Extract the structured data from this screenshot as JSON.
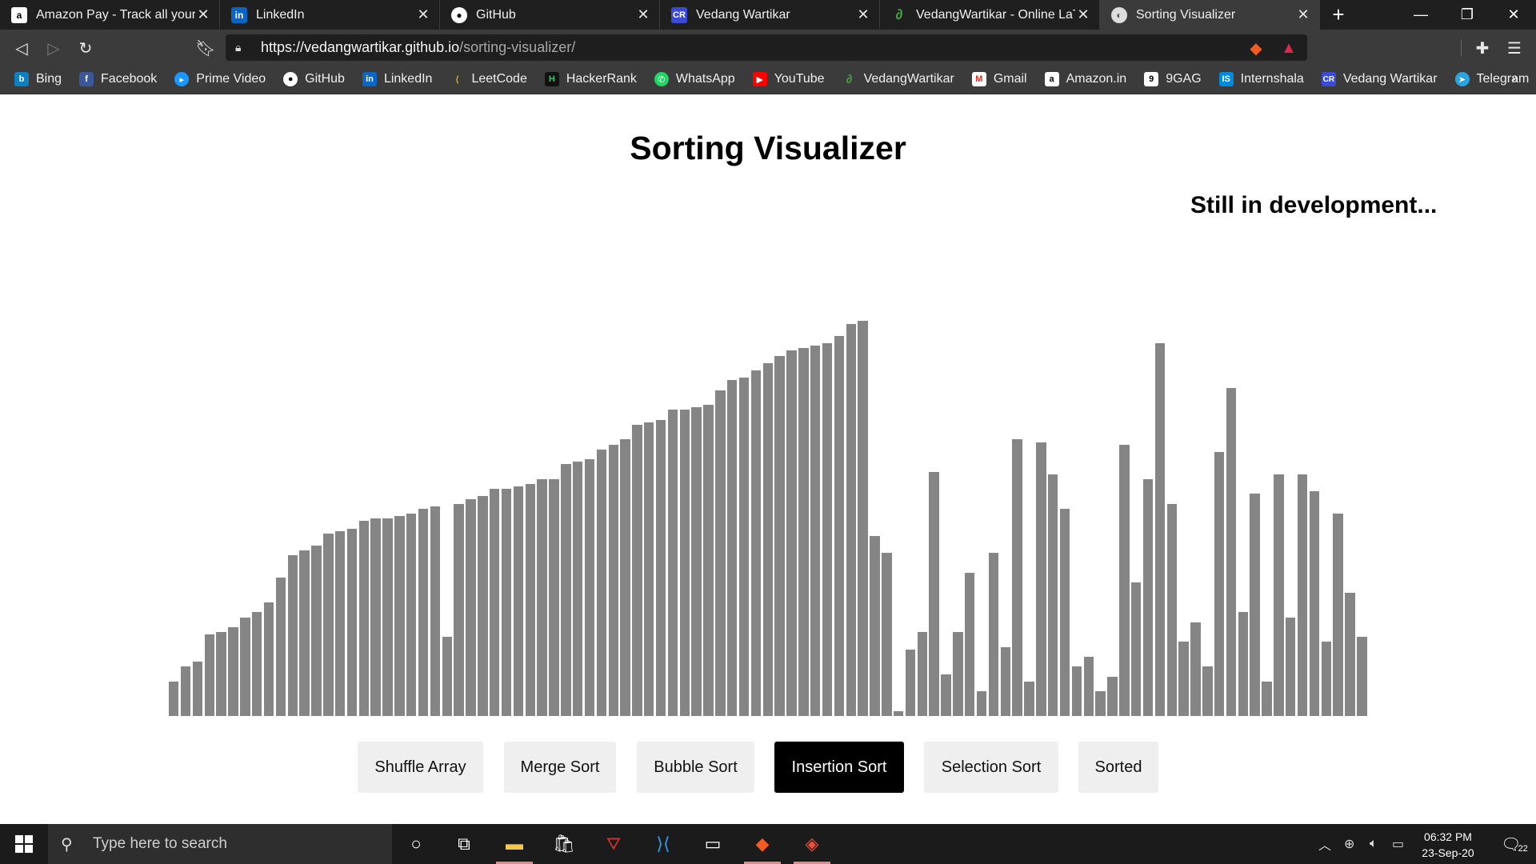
{
  "browser": {
    "tabs": [
      {
        "title": "Amazon Pay - Track all your payments",
        "icon": "amazon-icon",
        "active": false
      },
      {
        "title": "LinkedIn",
        "icon": "linkedin-icon",
        "active": false
      },
      {
        "title": "GitHub",
        "icon": "github-icon",
        "active": false
      },
      {
        "title": "Vedang Wartikar",
        "icon": "cr-icon",
        "active": false
      },
      {
        "title": "VedangWartikar - Online LaTeX",
        "icon": "overleaf-icon",
        "active": false
      },
      {
        "title": "Sorting Visualizer",
        "icon": "globe-icon",
        "active": true
      }
    ],
    "new_tab_label": "+",
    "url_host": "https://vedangwartikar.github.io",
    "url_path": "/sorting-visualizer/",
    "bookmarks": [
      {
        "label": "Bing",
        "icon": "bing-icon",
        "color": "#0e7fbf"
      },
      {
        "label": "Facebook",
        "icon": "facebook-icon",
        "color": "#3b5998"
      },
      {
        "label": "Prime Video",
        "icon": "prime-video-icon",
        "color": "#1a98ff"
      },
      {
        "label": "GitHub",
        "icon": "github-icon",
        "color": "#333333"
      },
      {
        "label": "LinkedIn",
        "icon": "linkedin-icon",
        "color": "#0a66c2"
      },
      {
        "label": "LeetCode",
        "icon": "leetcode-icon",
        "color": "#e7a41c"
      },
      {
        "label": "HackerRank",
        "icon": "hackerrank-icon",
        "color": "#111111"
      },
      {
        "label": "WhatsApp",
        "icon": "whatsapp-icon",
        "color": "#25d366"
      },
      {
        "label": "YouTube",
        "icon": "youtube-icon",
        "color": "#ff0000"
      },
      {
        "label": "VedangWartikar",
        "icon": "overleaf-icon",
        "color": "#47a141"
      },
      {
        "label": "Gmail",
        "icon": "gmail-icon",
        "color": "#d93025"
      },
      {
        "label": "Amazon.in",
        "icon": "amazon-icon",
        "color": "#ffffff"
      },
      {
        "label": "9GAG",
        "icon": "9gag-icon",
        "color": "#ffffff"
      },
      {
        "label": "Internshala",
        "icon": "internshala-icon",
        "color": "#008bdc"
      },
      {
        "label": "Vedang Wartikar",
        "icon": "cr-icon",
        "color": "#3c4bd6"
      },
      {
        "label": "Telegram",
        "icon": "telegram-icon",
        "color": "#2aa3df"
      }
    ],
    "bookmarks_more": "»"
  },
  "page": {
    "title": "Sorting Visualizer",
    "dev_note": "Still in development...",
    "bar_color": "#858585",
    "bar_max": 100,
    "bars": [
      7,
      10,
      11,
      16.5,
      17,
      18,
      20,
      21,
      23,
      28,
      32.5,
      33.5,
      34.5,
      37,
      37.5,
      38,
      39.5,
      40,
      40,
      40.5,
      41,
      42,
      42.5,
      16,
      43,
      44,
      44.5,
      46,
      46,
      46.5,
      47,
      48,
      48,
      51,
      51.5,
      52,
      54,
      55,
      56,
      59,
      59.5,
      60,
      62,
      62,
      62.5,
      63,
      66,
      68,
      68.5,
      70,
      71.5,
      73,
      74,
      74.5,
      75,
      75.5,
      77,
      79.5,
      80,
      36.5,
      33,
      1,
      13.5,
      17,
      49.5,
      8.5,
      17,
      29,
      5,
      33,
      14,
      56,
      7,
      55.5,
      49,
      42,
      10,
      12,
      5,
      8,
      55,
      27,
      48,
      75.5,
      43,
      15,
      19,
      10,
      53.5,
      66.5,
      21,
      45,
      7,
      49,
      20,
      49,
      45.5,
      15,
      41,
      25,
      16
    ],
    "buttons": [
      {
        "label": "Shuffle Array",
        "active": false
      },
      {
        "label": "Merge Sort",
        "active": false
      },
      {
        "label": "Bubble Sort",
        "active": false
      },
      {
        "label": "Insertion Sort",
        "active": true
      },
      {
        "label": "Selection Sort",
        "active": false
      },
      {
        "label": "Sorted",
        "active": false
      }
    ]
  },
  "taskbar": {
    "search_placeholder": "Type here to search",
    "time": "06:32 PM",
    "date": "23-Sep-20",
    "notification_count": "22"
  }
}
